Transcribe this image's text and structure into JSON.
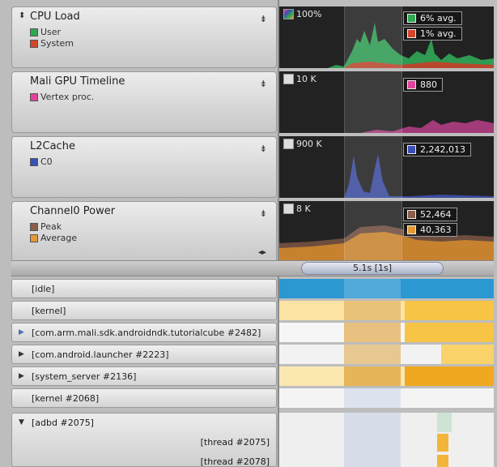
{
  "charts": [
    {
      "id": "cpu",
      "title": "CPU Load",
      "series": [
        {
          "label": "User",
          "color": "#2fa84f"
        },
        {
          "label": "System",
          "color": "#d2472b"
        }
      ],
      "scale": {
        "label": "100%",
        "icon": "gradient-swatch-icon"
      },
      "values": [
        {
          "text": "6% avg.",
          "color": "#2fa84f"
        },
        {
          "text": "1% avg.",
          "color": "#d2472b"
        }
      ]
    },
    {
      "id": "gpu",
      "title": "Mali GPU Timeline",
      "series": [
        {
          "label": "Vertex proc.",
          "color": "#e0449b"
        }
      ],
      "scale": {
        "label": "10 K"
      },
      "values": [
        {
          "text": "880",
          "color": "#e0449b"
        }
      ]
    },
    {
      "id": "l2",
      "title": "L2Cache",
      "series": [
        {
          "label": "C0",
          "color": "#3a4fb6"
        }
      ],
      "scale": {
        "label": "900 K"
      },
      "values": [
        {
          "text": "2,242,013",
          "color": "#3a4fb6"
        }
      ]
    },
    {
      "id": "power",
      "title": "Channel0 Power",
      "series": [
        {
          "label": "Peak",
          "color": "#8a5e49"
        },
        {
          "label": "Average",
          "color": "#e39a35"
        }
      ],
      "scale": {
        "label": "8 K"
      },
      "values": [
        {
          "text": "52,464",
          "color": "#8a5e49"
        },
        {
          "text": "40,363",
          "color": "#e39a35"
        }
      ]
    }
  ],
  "timebar": {
    "label": "5.1s [1s]"
  },
  "processes": [
    {
      "label": "[idle]",
      "expander": ""
    },
    {
      "label": "[kernel]",
      "expander": ""
    },
    {
      "label": "[com.arm.mali.sdk.androidndk.tutorialcube #2482]",
      "expander": "▶"
    },
    {
      "label": "[com.android.launcher #2223]",
      "expander": "▶"
    },
    {
      "label": "[system_server #2136]",
      "expander": "▶"
    },
    {
      "label": "[kernel #2068]",
      "expander": ""
    },
    {
      "label": "[adbd #2075]",
      "expander": "▼"
    }
  ],
  "threads": [
    {
      "label": "[thread #2075]"
    },
    {
      "label": "[thread #2078]"
    }
  ],
  "icons": {
    "collapse": "sort-caret-icon",
    "pin": "pin-icon",
    "expand": "horizontal-resize-icon"
  }
}
